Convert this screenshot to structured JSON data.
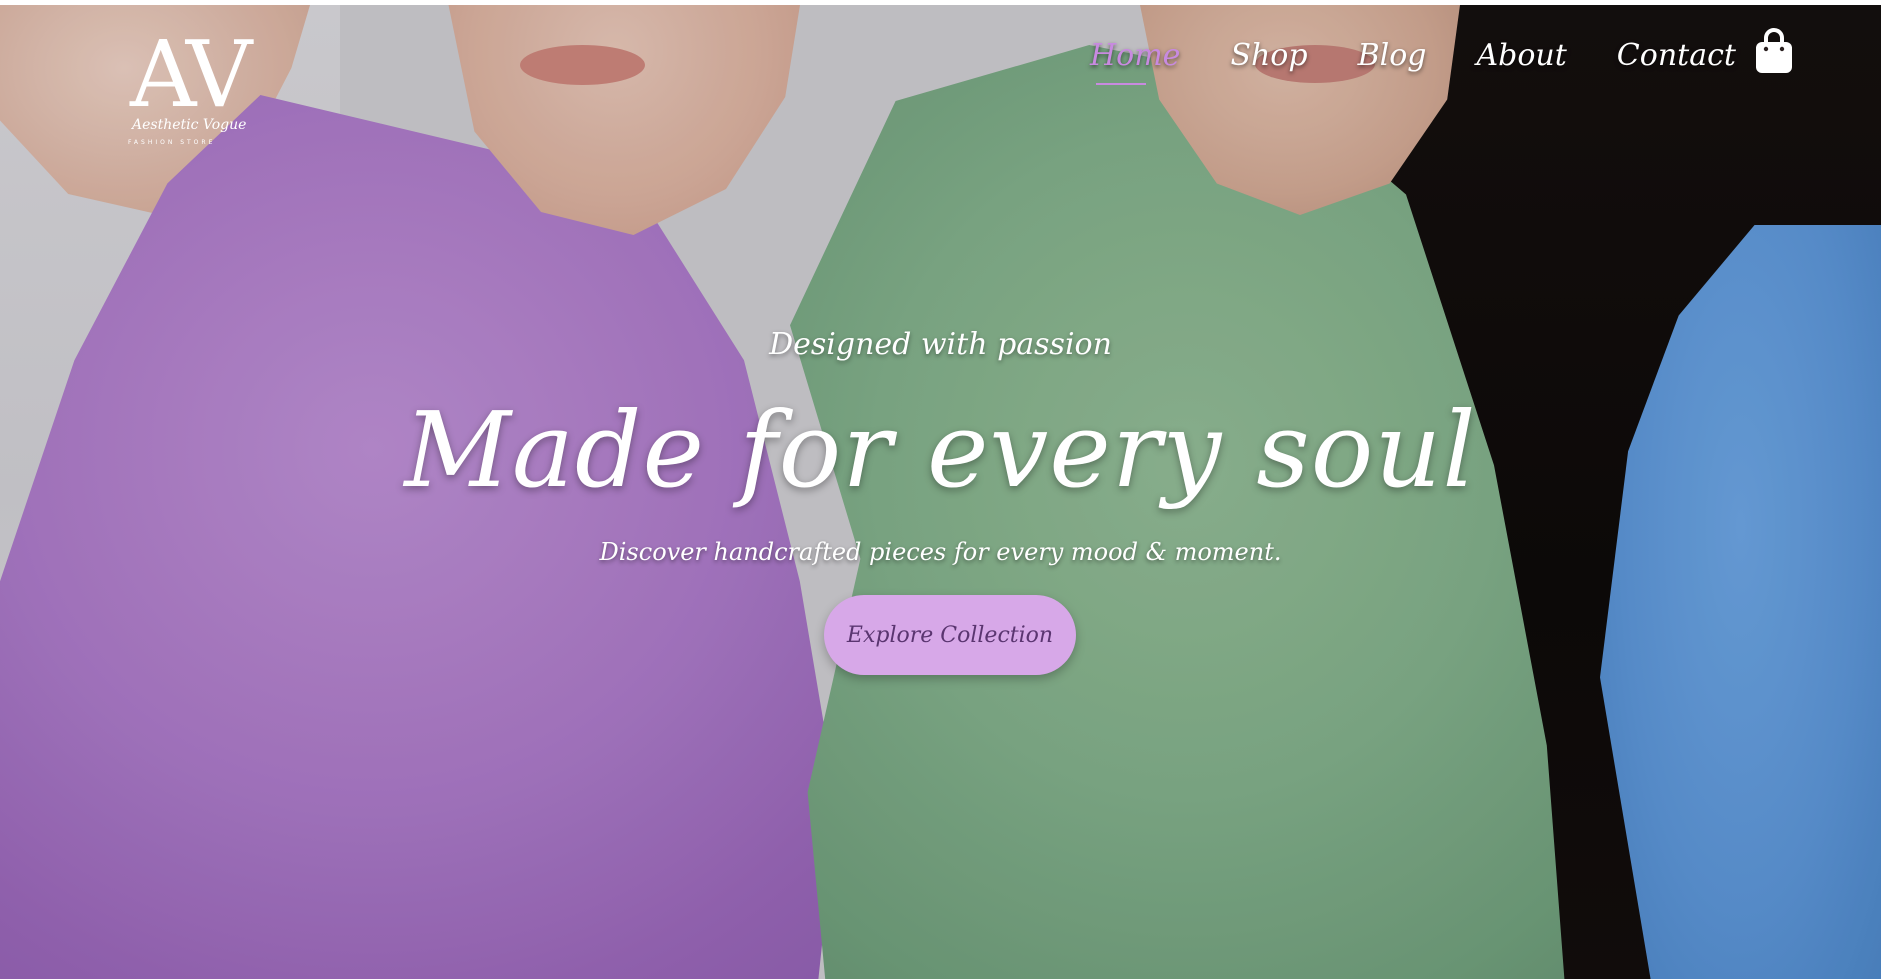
{
  "brand": {
    "logo_letters": "AV",
    "logo_name": "Aesthetic Vogue",
    "logo_tagline": "FASHION STORE"
  },
  "nav": {
    "items": [
      {
        "label": "Home",
        "active": true
      },
      {
        "label": "Shop",
        "active": false
      },
      {
        "label": "Blog",
        "active": false
      },
      {
        "label": "About",
        "active": false
      },
      {
        "label": "Contact",
        "active": false
      }
    ],
    "cart_icon": "shopping-bag-icon",
    "active_color": "#c88ae0"
  },
  "hero": {
    "subtitle": "Designed with passion",
    "headline": "Made for every soul",
    "tagline": "Discover handcrafted pieces for every mood & moment.",
    "cta_label": "Explore Collection",
    "cta_color": "#d7a8e8"
  }
}
